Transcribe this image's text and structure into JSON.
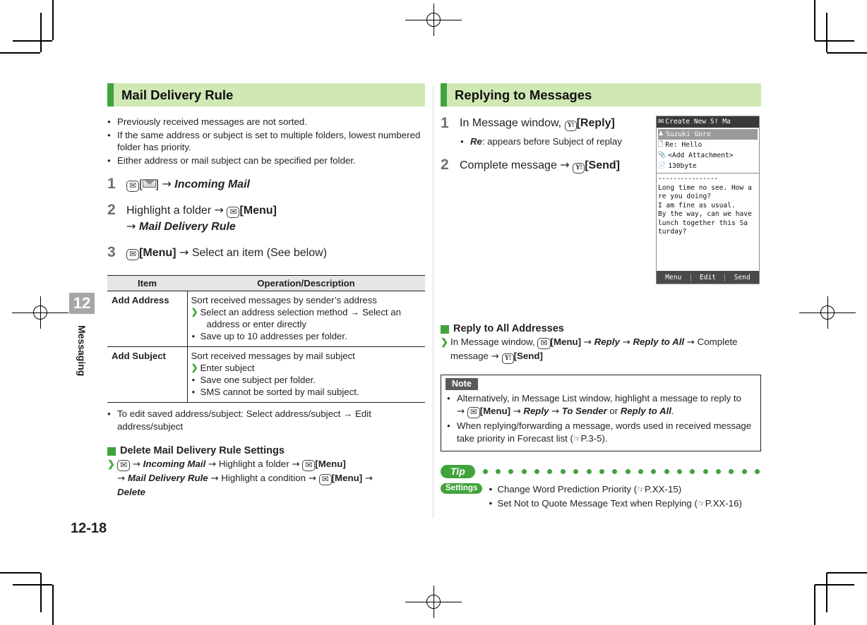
{
  "page": {
    "number": "12-18",
    "chapter_number": "12",
    "chapter_name": "Messaging"
  },
  "left_column": {
    "section_title": "Mail Delivery Rule",
    "intro_bullets": [
      "Previously received messages are not sorted.",
      "If the same address or subject is set to multiple folders, lowest numbered folder has priority.",
      "Either address or mail subject can be specified per folder."
    ],
    "steps": [
      {
        "number": "1",
        "key1": "mail-key",
        "bracket_icon": "envelope",
        "arrow": "→",
        "target": "Incoming Mail"
      },
      {
        "number": "2",
        "number_label": "2",
        "text_a": "Highlight a folder",
        "key": "mail-key",
        "key_label": "[Menu]",
        "target": "Mail Delivery Rule"
      },
      {
        "number": "3",
        "key": "mail-key",
        "key_label": "[Menu]",
        "text_a": "Select an item (See below)"
      }
    ],
    "table": {
      "headers": [
        "Item",
        "Operation/Description"
      ],
      "rows": [
        {
          "item": "Add Address",
          "lines": [
            {
              "kind": "plain",
              "text": "Sort received messages by sender’s address"
            },
            {
              "kind": "gt",
              "text": "Select an address selection method → Select an",
              "cont": "address or enter directly"
            },
            {
              "kind": "dot",
              "text": "Save up to 10 addresses per folder."
            }
          ]
        },
        {
          "item": "Add Subject",
          "lines": [
            {
              "kind": "plain",
              "text": "Sort received messages by mail subject"
            },
            {
              "kind": "gt",
              "text": "Enter subject"
            },
            {
              "kind": "dot",
              "text": "Save one subject per folder."
            },
            {
              "kind": "dot",
              "text": "SMS cannot be sorted by mail subject."
            }
          ]
        }
      ]
    },
    "after_table_bullet": "To edit saved address/subject: Select address/subject → Edit address/subject",
    "sub_section": {
      "title": "Delete Mail Delivery Rule Settings",
      "line1_target1": "Incoming Mail",
      "line1_text": "Highlight a folder",
      "line1_key_label": "[Menu]",
      "line2_target": "Mail Delivery Rule",
      "line2_text": "Highlight a condition",
      "line2_key_label": "[Menu]",
      "line3_target": "Delete"
    }
  },
  "right_column": {
    "section_title": "Replying to Messages",
    "steps": [
      {
        "number": "1",
        "text_a": "In Message window,",
        "key": "yahoo-key",
        "key_label": "[Reply]",
        "sub": "Re: appears before Subject of replay",
        "sub_italic": "Re"
      },
      {
        "number": "2",
        "text_a": "Complete message",
        "arrow": "→",
        "key": "yahoo-key",
        "key_label": "[Send]"
      }
    ],
    "phone_screen": {
      "title": "Create New S! Ma",
      "fields": [
        {
          "icon": "person-icon",
          "text": "Suzuki Goro",
          "selected": true
        },
        {
          "icon": "subject-icon",
          "text": "Re: Hello",
          "selected": false
        },
        {
          "icon": "attachment-icon",
          "text": "<Add Attachment>",
          "selected": false
        },
        {
          "icon": "size-icon",
          "text": "130byte",
          "selected": false
        }
      ],
      "divider": "----------------",
      "body_lines": [
        "Long time no see. How a",
        "re you doing?",
        "I am fine as usual.",
        "By the way, can we have",
        " lunch together this Sa",
        "turday?"
      ],
      "softkeys": [
        "Menu",
        "Edit",
        "Send"
      ]
    },
    "sub_section": {
      "title": "Reply to All Addresses",
      "text_a": "In Message window,",
      "key1_label": "[Menu]",
      "target1": "Reply",
      "target2": "Reply to All",
      "text_b": "Complete message",
      "key2_label": "[Send]"
    },
    "note": {
      "tab_label": "Note",
      "bullets": [
        {
          "pre": "Alternatively, in Message List window, highlight a message to reply to",
          "key_label": "[Menu]",
          "t1": "Reply",
          "t2": "To Sender",
          "or": "or",
          "t3": "Reply to All",
          "end": "."
        },
        {
          "text": "When replying/forwarding a message, words used in received message take priority in Forecast list (",
          "ref": "P.3-5",
          "end": ")."
        }
      ]
    },
    "tip": {
      "badge": "Tip",
      "settings_badge": "Settings",
      "dot_count": 22,
      "lines": [
        {
          "text": "Change Word Prediction Priority (",
          "ref": "P.XX-15",
          "end": ")"
        },
        {
          "text": "Set Not to Quote Message Text when Replying (",
          "ref": "P.XX-16",
          "end": ")"
        }
      ]
    }
  },
  "colors": {
    "green_accent": "#41a33c",
    "green_header_bg": "#cfe8b4",
    "table_header_bg": "#e6e6e6",
    "tab_gray": "#a6a6a6"
  }
}
